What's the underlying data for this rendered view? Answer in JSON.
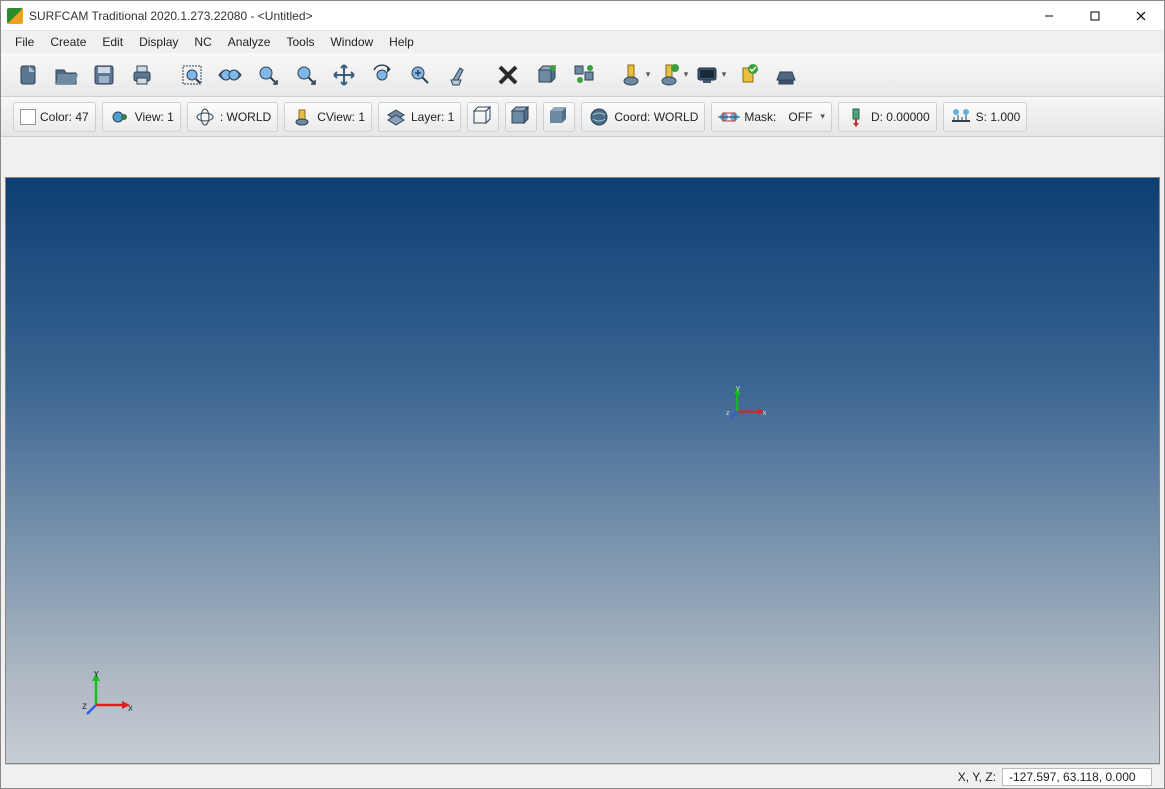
{
  "title": "SURFCAM Traditional 2020.1.273.22080 - <Untitled>",
  "menus": [
    "File",
    "Create",
    "Edit",
    "Display",
    "NC",
    "Analyze",
    "Tools",
    "Window",
    "Help"
  ],
  "toolbar_icons": [
    "new-file",
    "open-file",
    "save-file",
    "print",
    "zoom-window",
    "zoom-dynamic",
    "zoom-all",
    "zoom-previous",
    "pan",
    "rotate-view",
    "zoom-extents",
    "clean",
    "delete",
    "box-cut",
    "arrange",
    "tool-yellow",
    "tool-green",
    "screen-icon",
    "verify",
    "printer3d"
  ],
  "props": {
    "color_label": "Color: 47",
    "view_label": "View: 1",
    "world_label": ": WORLD",
    "cview_label": "CView: 1",
    "layer_label": "Layer: 1",
    "coord_label": "Coord: WORLD",
    "mask_label": "Mask:",
    "mask_value": "OFF",
    "d_label": "D: 0.00000",
    "s_label": "S: 1.000"
  },
  "axes": {
    "x": "x",
    "y": "Y",
    "z": "z"
  },
  "status": {
    "label": "X, Y, Z:",
    "value": "-127.597, 63.118, 0.000"
  }
}
